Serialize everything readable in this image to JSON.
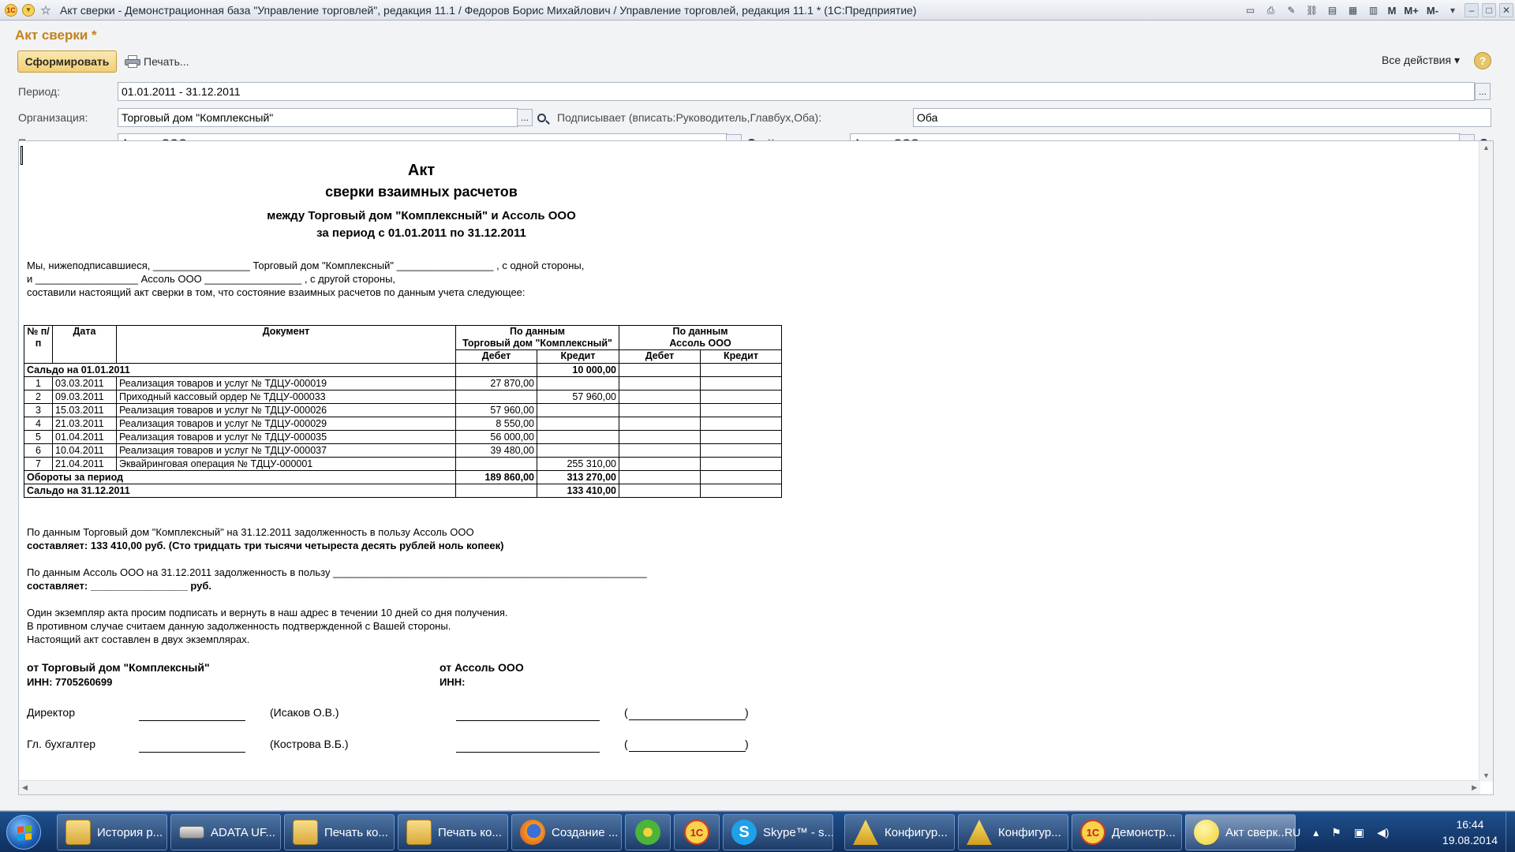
{
  "window": {
    "title": "Акт сверки - Демонстрационная база \"Управление торговлей\", редакция 11.1 / Федоров Борис Михайлович / Управление торговлей, редакция 11.1 * (1С:Предприятие)",
    "m_labels": [
      "M",
      "M+",
      "M-"
    ]
  },
  "form": {
    "title": "Акт сверки *",
    "generate_button": "Сформировать",
    "print_button": "Печать...",
    "all_actions": "Все действия",
    "help": "?",
    "period_label": "Период:",
    "period_value": "01.01.2011 - 31.12.2011",
    "org_label": "Организация:",
    "org_value": "Торговый дом \"Комплексный\"",
    "signer_label": "Подписывает (вписать:Руководитель,Главбух,Оба):",
    "signer_value": "Оба",
    "partner_label": "Партнер:",
    "partner_value": "Ассоль ООО",
    "counterparty_label": "Контрагент:",
    "counterparty_value": "Ассоль ООО",
    "select_btn": "..."
  },
  "report": {
    "h1": "Акт",
    "h2": "сверки взаимных расчетов",
    "h3": "между Торговый дом \"Комплексный\" и Ассоль ООО",
    "h4": "за период с 01.01.2011 по 31.12.2011",
    "intro1": "Мы, нижеподписавшиеся, _________________ Торговый дом \"Комплексный\" _________________ , с одной стороны,",
    "intro2": "и __________________  Ассоль ООО _________________ , с другой стороны,",
    "intro3": "составили настоящий акт сверки в том, что состояние взаимных расчетов по данным учета следующее:",
    "columns": {
      "num": "№ п/п",
      "date": "Дата",
      "doc": "Документ",
      "by_us": "По данным",
      "by_us2": "Торговый дом \"Комплексный\"",
      "by_them": "По данным",
      "by_them2": "Ассоль ООО",
      "debit": "Дебет",
      "credit": "Кредит"
    },
    "opening": {
      "label": "Сальдо на 01.01.2011",
      "debit": "",
      "credit": "10 000,00"
    },
    "rows": [
      {
        "n": "1",
        "date": "03.03.2011",
        "doc": "Реализация товаров и услуг  № ТДЦУ-000019",
        "debit": "27 870,00",
        "credit": ""
      },
      {
        "n": "2",
        "date": "09.03.2011",
        "doc": "Приходный кассовый ордер  № ТДЦУ-000033",
        "debit": "",
        "credit": "57 960,00"
      },
      {
        "n": "3",
        "date": "15.03.2011",
        "doc": "Реализация товаров и услуг  № ТДЦУ-000026",
        "debit": "57 960,00",
        "credit": ""
      },
      {
        "n": "4",
        "date": "21.03.2011",
        "doc": "Реализация товаров и услуг  № ТДЦУ-000029",
        "debit": "8 550,00",
        "credit": ""
      },
      {
        "n": "5",
        "date": "01.04.2011",
        "doc": "Реализация товаров и услуг  № ТДЦУ-000035",
        "debit": "56 000,00",
        "credit": ""
      },
      {
        "n": "6",
        "date": "10.04.2011",
        "doc": "Реализация товаров и услуг  № ТДЦУ-000037",
        "debit": "39 480,00",
        "credit": ""
      },
      {
        "n": "7",
        "date": "21.04.2011",
        "doc": "Эквайринговая операция  № ТДЦУ-000001",
        "debit": "",
        "credit": "255 310,00"
      }
    ],
    "turnover": {
      "label": "Обороты за период",
      "debit": "189 860,00",
      "credit": "313 270,00"
    },
    "closing": {
      "label": "Сальдо на 31.12.2011",
      "debit": "",
      "credit": "133 410,00"
    },
    "debt1": "По данным Торговый дом \"Комплексный\" на 31.12.2011 задолженность в пользу Ассоль ООО",
    "debt1b": "составляет: 133 410,00 руб. (Сто тридцать три тысячи четыреста десять рублей ноль копеек)",
    "debt2": "По данным Ассоль ООО на 31.12.2011 задолженность в пользу _______________________________________________________",
    "debt2b": "составляет: _________________ руб.",
    "note1": "Один экземпляр акта просим подписать и вернуть в наш адрес в течении 10 дней со дня получения.",
    "note2": "В противном случае считаем данную задолженность подтвержденной с Вашей стороны.",
    "note3": "Настоящий акт составлен в двух экземплярах.",
    "from_us": "от Торговый дом \"Комплексный\"",
    "inn_us": "ИНН: 7705260699",
    "from_them": "от Ассоль ООО",
    "inn_them": "ИНН:",
    "director": "Директор",
    "director_name": "(Исаков О.В.)",
    "accountant": "Гл. бухгалтер",
    "accountant_name": "(Кострова В.Б.)",
    "paren_open": "(",
    "paren_close": ")"
  },
  "taskbar": {
    "items": [
      {
        "label": "История р...",
        "icon": "folder-icon"
      },
      {
        "label": "ADATA UF...",
        "icon": "drive-icon"
      },
      {
        "label": "Печать ко...",
        "icon": "folder-icon"
      },
      {
        "label": "Печать ко...",
        "icon": "folder-icon"
      },
      {
        "label": "Создание ...",
        "icon": "firefox-icon"
      },
      {
        "label": "",
        "icon": "icq-icon"
      },
      {
        "label": "",
        "icon": "1c-icon"
      },
      {
        "label": "Skype™ - s...",
        "icon": "skype-icon"
      },
      {
        "label": "Конфигур...",
        "icon": "configurator-icon"
      },
      {
        "label": "Конфигур...",
        "icon": "configurator-icon"
      },
      {
        "label": "Демонстр...",
        "icon": "1c-icon"
      },
      {
        "label": "Акт сверк...",
        "icon": "1c-app-icon"
      }
    ],
    "lang": "RU",
    "time": "16:44",
    "date": "19.08.2014"
  }
}
